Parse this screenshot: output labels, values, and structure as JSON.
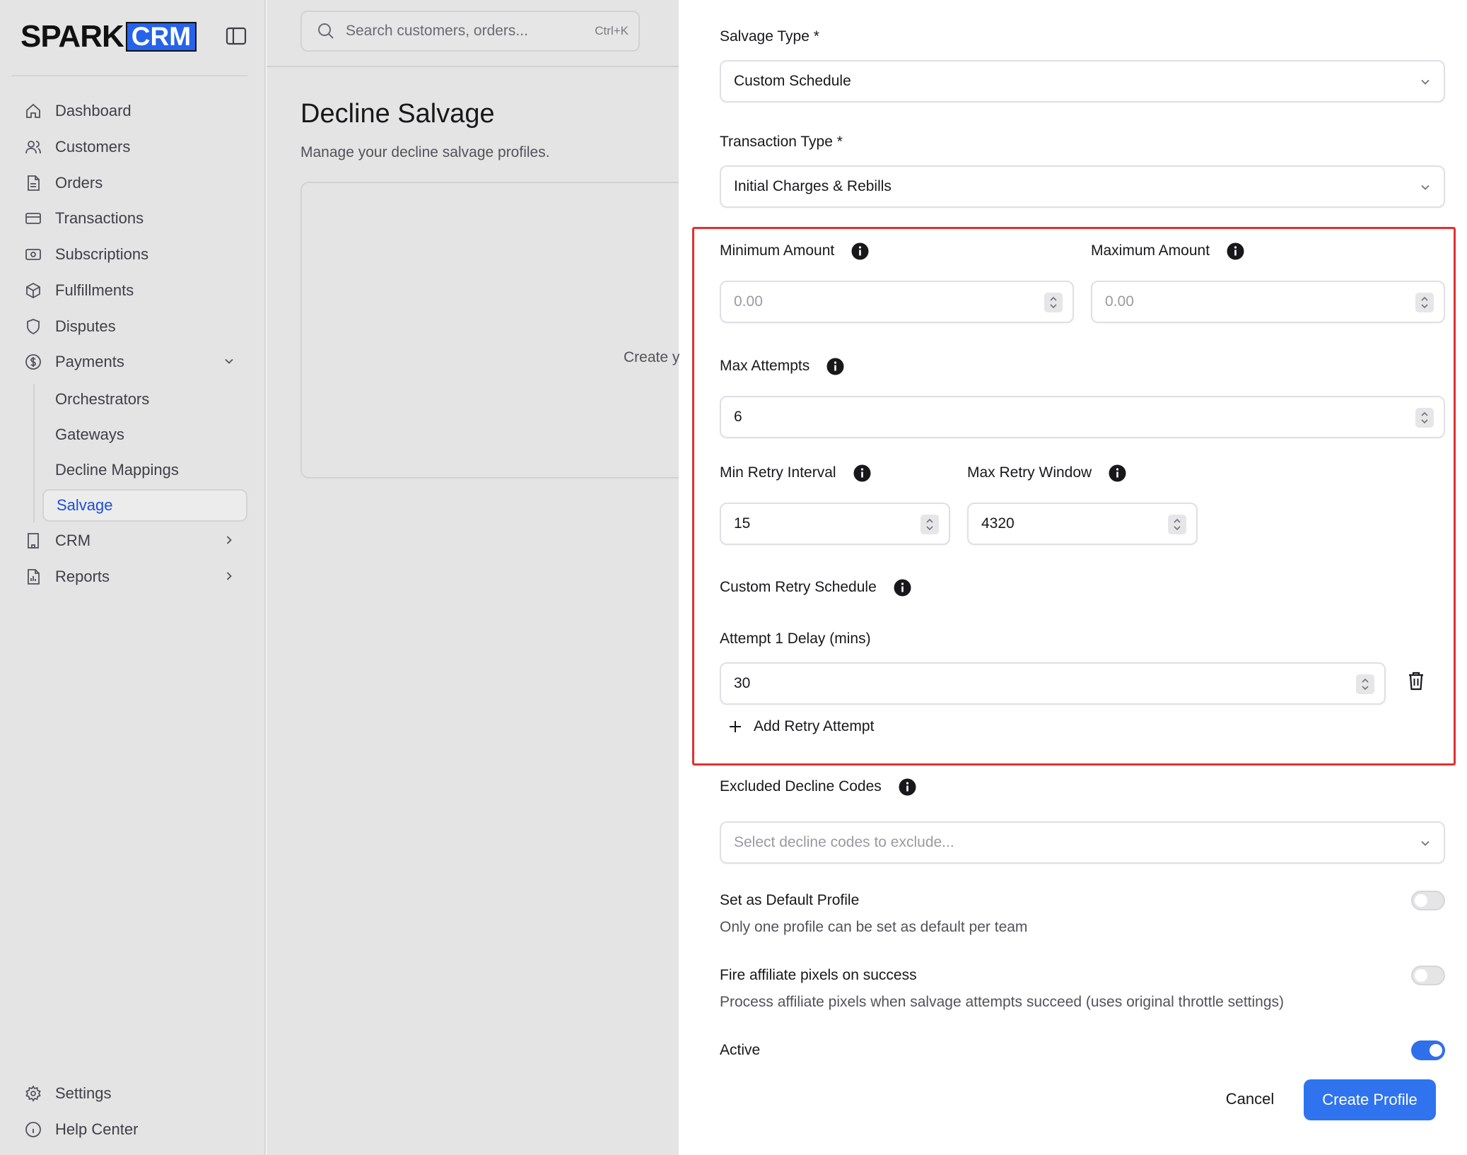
{
  "brand": {
    "name_part1": "SPARK",
    "name_part2": "CRM"
  },
  "search": {
    "placeholder": "Search customers, orders...",
    "shortcut": "Ctrl+K"
  },
  "sidebar": {
    "items": [
      {
        "label": "Dashboard",
        "icon": "home-icon"
      },
      {
        "label": "Customers",
        "icon": "users-icon"
      },
      {
        "label": "Orders",
        "icon": "file-icon"
      },
      {
        "label": "Transactions",
        "icon": "credit-card-icon"
      },
      {
        "label": "Subscriptions",
        "icon": "banknote-icon"
      },
      {
        "label": "Fulfillments",
        "icon": "package-icon"
      },
      {
        "label": "Disputes",
        "icon": "shield-icon"
      },
      {
        "label": "Payments",
        "icon": "dollar-circle-icon",
        "expanded": true
      }
    ],
    "payments_sub": [
      "Orchestrators",
      "Gateways",
      "Decline Mappings",
      "Salvage"
    ],
    "active_sub": "Salvage",
    "items_after": [
      {
        "label": "CRM",
        "icon": "building-icon"
      },
      {
        "label": "Reports",
        "icon": "report-icon"
      }
    ],
    "footer": [
      {
        "label": "Settings",
        "icon": "gear-icon"
      },
      {
        "label": "Help Center",
        "icon": "info-circle-icon"
      }
    ]
  },
  "main": {
    "title": "Decline Salvage",
    "subtitle": "Manage your decline salvage profiles.",
    "empty_text": "Create y"
  },
  "form": {
    "salvage_type": {
      "label": "Salvage Type *",
      "value": "Custom Schedule"
    },
    "transaction_type": {
      "label": "Transaction Type *",
      "value": "Initial Charges & Rebills"
    },
    "min_amount": {
      "label": "Minimum Amount",
      "placeholder": "0.00"
    },
    "max_amount": {
      "label": "Maximum Amount",
      "placeholder": "0.00"
    },
    "max_attempts": {
      "label": "Max Attempts",
      "value": "6"
    },
    "min_retry_interval": {
      "label": "Min Retry Interval",
      "value": "15"
    },
    "max_retry_window": {
      "label": "Max Retry Window",
      "value": "4320"
    },
    "custom_retry_schedule": {
      "label": "Custom Retry Schedule"
    },
    "attempt1": {
      "label": "Attempt 1 Delay (mins)",
      "value": "30"
    },
    "add_retry_label": "Add Retry Attempt",
    "excluded_codes": {
      "label": "Excluded Decline Codes",
      "placeholder": "Select decline codes to exclude..."
    },
    "default_profile": {
      "label": "Set as Default Profile",
      "help": "Only one profile can be set as default per team",
      "on": false
    },
    "affiliate_pixels": {
      "label": "Fire affiliate pixels on success",
      "help": "Process affiliate pixels when salvage attempts succeed (uses original throttle settings)",
      "on": false
    },
    "active": {
      "label": "Active",
      "on": true
    },
    "cancel_label": "Cancel",
    "create_label": "Create Profile"
  },
  "colors": {
    "accent": "#2f73ee",
    "highlight_border": "#e03131",
    "active_nav": "#1d4ed8"
  }
}
